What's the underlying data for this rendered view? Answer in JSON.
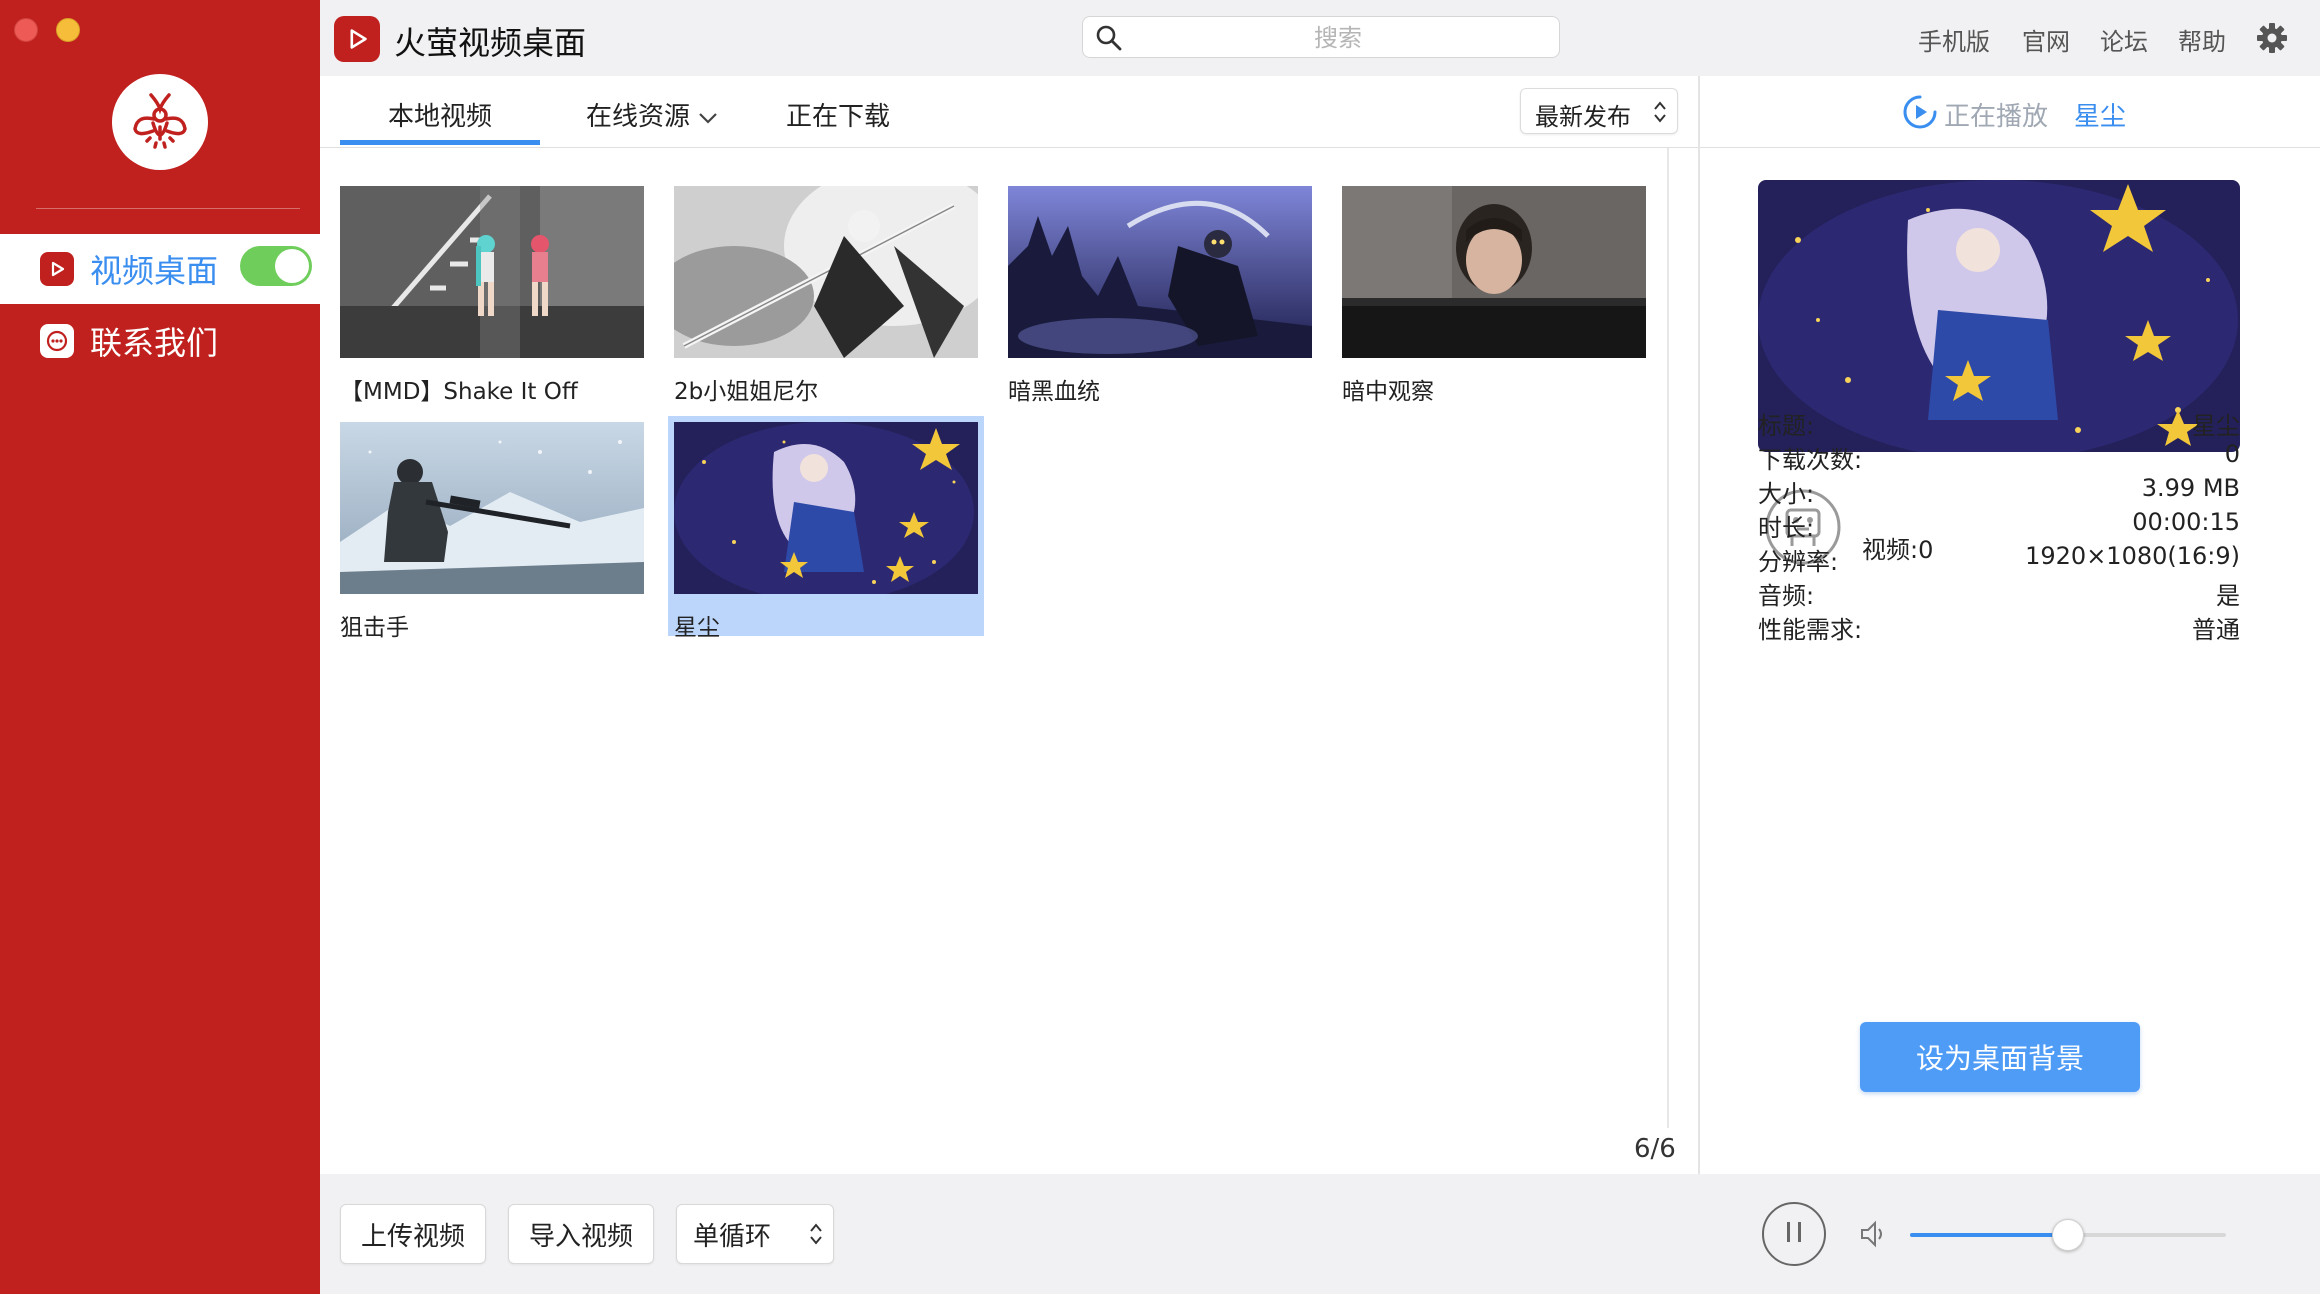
{
  "app": {
    "title": "火萤视频桌面"
  },
  "sidebar": {
    "items": [
      {
        "label": "视频桌面",
        "icon": "play-square-icon",
        "active": true,
        "toggle_on": true
      },
      {
        "label": "联系我们",
        "icon": "chat-bubble-icon",
        "active": false
      }
    ]
  },
  "search": {
    "placeholder": "搜索"
  },
  "top_links": [
    "手机版",
    "官网",
    "论坛",
    "帮助"
  ],
  "tabs": [
    {
      "label": "本地视频",
      "active": true
    },
    {
      "label": "在线资源",
      "has_dropdown": true
    },
    {
      "label": "正在下载"
    }
  ],
  "sort": {
    "selected": "最新发布"
  },
  "videos": [
    {
      "title": "【MMD】Shake It Off"
    },
    {
      "title": "2b小姐姐尼尔"
    },
    {
      "title": "暗黑血统"
    },
    {
      "title": "暗中观察"
    },
    {
      "title": "狙击手"
    },
    {
      "title": "星尘",
      "selected": true
    }
  ],
  "pagination": {
    "text": "6/6"
  },
  "now_playing": {
    "label": "正在播放",
    "name": "星尘",
    "video_count": "视频:0",
    "info": [
      {
        "key": "标题:",
        "value": "星尘"
      },
      {
        "key": "下载次数:",
        "value": "0"
      },
      {
        "key": "大小:",
        "value": "3.99 MB"
      },
      {
        "key": "时长:",
        "value": "00:00:15"
      },
      {
        "key": "分辨率:",
        "value": "1920×1080(16:9)"
      },
      {
        "key": "音频:",
        "value": "是"
      },
      {
        "key": "性能需求:",
        "value": "普通"
      }
    ],
    "set_bg_label": "设为桌面背景"
  },
  "bottom": {
    "upload_label": "上传视频",
    "import_label": "导入视频",
    "loop_selected": "单循环",
    "volume_fraction": 0.5
  },
  "colors": {
    "brand_red": "#c0211e",
    "accent_blue": "#3a8ef0",
    "toggle_green": "#6fce5b"
  }
}
